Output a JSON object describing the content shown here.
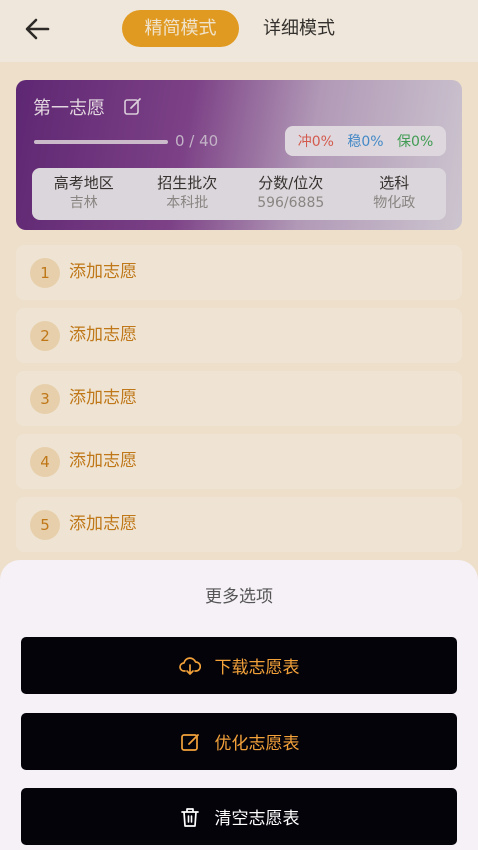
{
  "header": {
    "tabs": [
      {
        "label": "精简模式",
        "active": true
      },
      {
        "label": "详细模式",
        "active": false
      }
    ]
  },
  "card": {
    "title": "第一志愿",
    "progress": {
      "current": 0,
      "total": 40,
      "text": "0 / 40"
    },
    "ratios": {
      "chong": "冲0%",
      "wen": "稳0%",
      "bao": "保0%"
    },
    "info": [
      {
        "label": "高考地区",
        "value": "吉林"
      },
      {
        "label": "招生批次",
        "value": "本科批"
      },
      {
        "label": "分数/位次",
        "value": "596/6885"
      },
      {
        "label": "选科",
        "value": "物化政"
      }
    ]
  },
  "choices": [
    {
      "num": "1",
      "label": "添加志愿"
    },
    {
      "num": "2",
      "label": "添加志愿"
    },
    {
      "num": "3",
      "label": "添加志愿"
    },
    {
      "num": "4",
      "label": "添加志愿"
    },
    {
      "num": "5",
      "label": "添加志愿"
    }
  ],
  "sheet": {
    "title": "更多选项",
    "buttons": [
      {
        "label": "下载志愿表",
        "icon": "cloud-download-icon"
      },
      {
        "label": "优化志愿表",
        "icon": "edit-icon"
      },
      {
        "label": "清空志愿表",
        "icon": "trash-icon"
      }
    ]
  },
  "colors": {
    "accent": "#f0a21c",
    "chong": "#e05a4f",
    "wen": "#3d8ed8",
    "bao": "#3aa355",
    "sheet_button_bg": "#05030a"
  }
}
